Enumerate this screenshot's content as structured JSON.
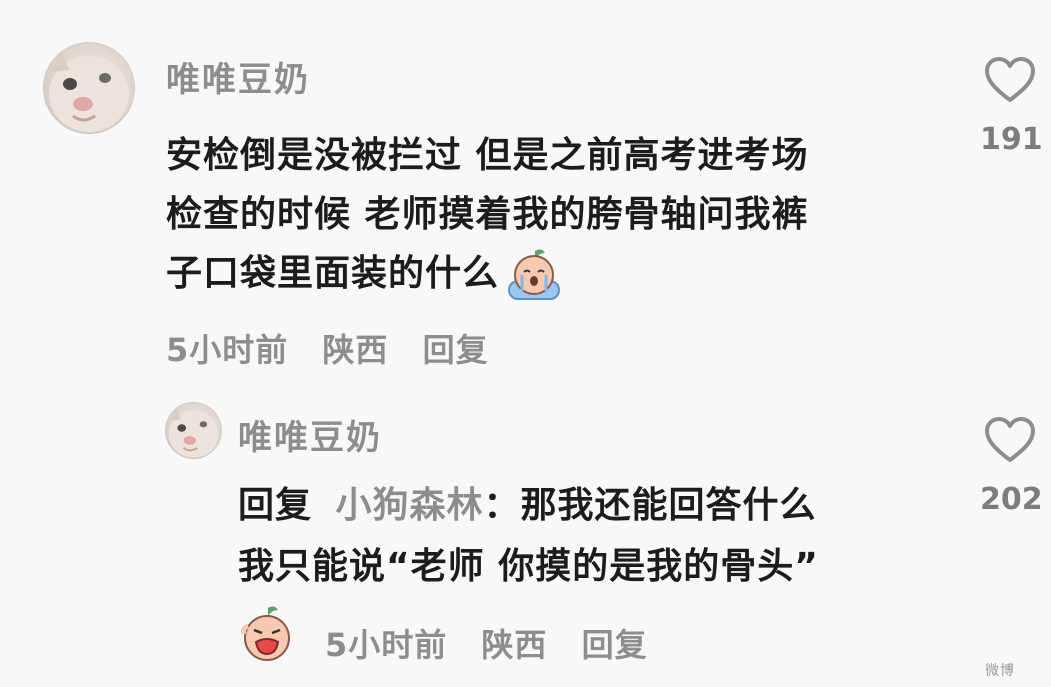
{
  "comments": [
    {
      "username": "唯唯豆奶",
      "text_lines": [
        "安检倒是没被拦过 但是之前高考进考场",
        "检查的时候 老师摸着我的胯骨轴问我裤",
        "子口袋里面装的什么"
      ],
      "emoji": "crying-peach-emoji",
      "time": "5小时前",
      "location": "陕西",
      "reply_label": "回复",
      "likes": "191"
    },
    {
      "username": "唯唯豆奶",
      "reply_prefix": "回复",
      "mention": "小狗森林",
      "text_first": "：那我还能回答什么",
      "text_second": "我只能说“老师 你摸的是我的骨头”",
      "emoji": "shouting-peach-emoji",
      "time": "5小时前",
      "location": "陕西",
      "reply_label": "回复",
      "likes": "202"
    }
  ],
  "watermark": "微博",
  "colors": {
    "background": "#f8f8f8",
    "text": "#1c1c1c",
    "muted": "#8d8d8d",
    "emoji_peach": "#f6c9b1",
    "emoji_leaf": "#5ca36a",
    "emoji_cushion": "#9cc7f0"
  },
  "icons": {
    "like": "heart-outline-icon",
    "avatar": "cat-avatar-icon"
  }
}
